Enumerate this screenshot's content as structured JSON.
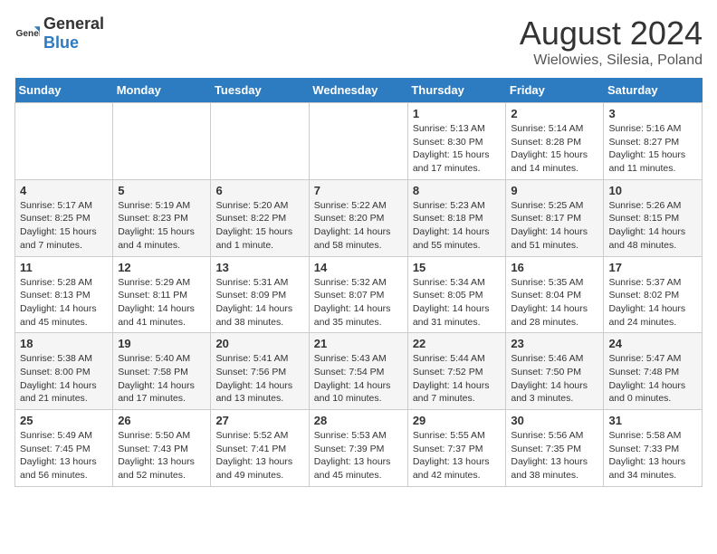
{
  "logo": {
    "text1": "General",
    "text2": "Blue"
  },
  "title": "August 2024",
  "subtitle": "Wielowies, Silesia, Poland",
  "headers": [
    "Sunday",
    "Monday",
    "Tuesday",
    "Wednesday",
    "Thursday",
    "Friday",
    "Saturday"
  ],
  "weeks": [
    [
      {
        "day": "",
        "info": ""
      },
      {
        "day": "",
        "info": ""
      },
      {
        "day": "",
        "info": ""
      },
      {
        "day": "",
        "info": ""
      },
      {
        "day": "1",
        "info": "Sunrise: 5:13 AM\nSunset: 8:30 PM\nDaylight: 15 hours and 17 minutes."
      },
      {
        "day": "2",
        "info": "Sunrise: 5:14 AM\nSunset: 8:28 PM\nDaylight: 15 hours and 14 minutes."
      },
      {
        "day": "3",
        "info": "Sunrise: 5:16 AM\nSunset: 8:27 PM\nDaylight: 15 hours and 11 minutes."
      }
    ],
    [
      {
        "day": "4",
        "info": "Sunrise: 5:17 AM\nSunset: 8:25 PM\nDaylight: 15 hours and 7 minutes."
      },
      {
        "day": "5",
        "info": "Sunrise: 5:19 AM\nSunset: 8:23 PM\nDaylight: 15 hours and 4 minutes."
      },
      {
        "day": "6",
        "info": "Sunrise: 5:20 AM\nSunset: 8:22 PM\nDaylight: 15 hours and 1 minute."
      },
      {
        "day": "7",
        "info": "Sunrise: 5:22 AM\nSunset: 8:20 PM\nDaylight: 14 hours and 58 minutes."
      },
      {
        "day": "8",
        "info": "Sunrise: 5:23 AM\nSunset: 8:18 PM\nDaylight: 14 hours and 55 minutes."
      },
      {
        "day": "9",
        "info": "Sunrise: 5:25 AM\nSunset: 8:17 PM\nDaylight: 14 hours and 51 minutes."
      },
      {
        "day": "10",
        "info": "Sunrise: 5:26 AM\nSunset: 8:15 PM\nDaylight: 14 hours and 48 minutes."
      }
    ],
    [
      {
        "day": "11",
        "info": "Sunrise: 5:28 AM\nSunset: 8:13 PM\nDaylight: 14 hours and 45 minutes."
      },
      {
        "day": "12",
        "info": "Sunrise: 5:29 AM\nSunset: 8:11 PM\nDaylight: 14 hours and 41 minutes."
      },
      {
        "day": "13",
        "info": "Sunrise: 5:31 AM\nSunset: 8:09 PM\nDaylight: 14 hours and 38 minutes."
      },
      {
        "day": "14",
        "info": "Sunrise: 5:32 AM\nSunset: 8:07 PM\nDaylight: 14 hours and 35 minutes."
      },
      {
        "day": "15",
        "info": "Sunrise: 5:34 AM\nSunset: 8:05 PM\nDaylight: 14 hours and 31 minutes."
      },
      {
        "day": "16",
        "info": "Sunrise: 5:35 AM\nSunset: 8:04 PM\nDaylight: 14 hours and 28 minutes."
      },
      {
        "day": "17",
        "info": "Sunrise: 5:37 AM\nSunset: 8:02 PM\nDaylight: 14 hours and 24 minutes."
      }
    ],
    [
      {
        "day": "18",
        "info": "Sunrise: 5:38 AM\nSunset: 8:00 PM\nDaylight: 14 hours and 21 minutes."
      },
      {
        "day": "19",
        "info": "Sunrise: 5:40 AM\nSunset: 7:58 PM\nDaylight: 14 hours and 17 minutes."
      },
      {
        "day": "20",
        "info": "Sunrise: 5:41 AM\nSunset: 7:56 PM\nDaylight: 14 hours and 13 minutes."
      },
      {
        "day": "21",
        "info": "Sunrise: 5:43 AM\nSunset: 7:54 PM\nDaylight: 14 hours and 10 minutes."
      },
      {
        "day": "22",
        "info": "Sunrise: 5:44 AM\nSunset: 7:52 PM\nDaylight: 14 hours and 7 minutes."
      },
      {
        "day": "23",
        "info": "Sunrise: 5:46 AM\nSunset: 7:50 PM\nDaylight: 14 hours and 3 minutes."
      },
      {
        "day": "24",
        "info": "Sunrise: 5:47 AM\nSunset: 7:48 PM\nDaylight: 14 hours and 0 minutes."
      }
    ],
    [
      {
        "day": "25",
        "info": "Sunrise: 5:49 AM\nSunset: 7:45 PM\nDaylight: 13 hours and 56 minutes."
      },
      {
        "day": "26",
        "info": "Sunrise: 5:50 AM\nSunset: 7:43 PM\nDaylight: 13 hours and 52 minutes."
      },
      {
        "day": "27",
        "info": "Sunrise: 5:52 AM\nSunset: 7:41 PM\nDaylight: 13 hours and 49 minutes."
      },
      {
        "day": "28",
        "info": "Sunrise: 5:53 AM\nSunset: 7:39 PM\nDaylight: 13 hours and 45 minutes."
      },
      {
        "day": "29",
        "info": "Sunrise: 5:55 AM\nSunset: 7:37 PM\nDaylight: 13 hours and 42 minutes."
      },
      {
        "day": "30",
        "info": "Sunrise: 5:56 AM\nSunset: 7:35 PM\nDaylight: 13 hours and 38 minutes."
      },
      {
        "day": "31",
        "info": "Sunrise: 5:58 AM\nSunset: 7:33 PM\nDaylight: 13 hours and 34 minutes."
      }
    ]
  ]
}
